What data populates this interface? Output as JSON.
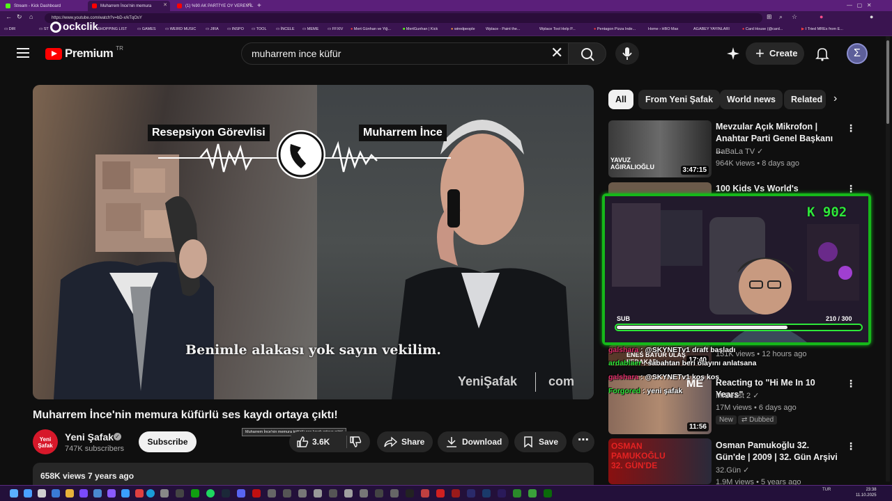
{
  "browser": {
    "tabs": [
      {
        "label": "Stream - Kick Dashboard",
        "color": "#53fc18"
      },
      {
        "label": "Muharrem İnce'nin memura",
        "color": "#ff0000"
      },
      {
        "label": "(1) %90 AK PARTİ'YE OY VEREN İL",
        "color": "#ff0000"
      }
    ],
    "new_tab": "+",
    "url": "https://www.youtube.com/watch?v=bD-x/kTqOsY",
    "bookmarks": [
      "DIR",
      "ST",
      "SHOPPING LIST",
      "GAMES",
      "WEIRD MUSIC",
      "JIRA",
      "INSPO",
      "TOOL",
      "İNCELE",
      "MEME",
      "FFXIV",
      "Mert Günhan ve Yiğ...",
      "MertGunhan | Kick",
      "wiredpeople",
      "Wplace - Paint the...",
      "Wplace Tool Help P...",
      "Pentagon Pizza Inde...",
      "Home › HBO Max",
      "AGABEY YAYINLARI",
      "Card House (@card...",
      "I Tried MREs from E..."
    ],
    "watermark": "ockclik"
  },
  "masthead": {
    "logo_text": "Premium",
    "country": "TR",
    "search_value": "muharrem ince küfür",
    "create_label": "Create",
    "avatar_glyph": "Σ"
  },
  "video": {
    "label_left": "Resepsiyon Görevlisi",
    "label_right": "Muharrem İnce",
    "subtitle": "Benimle alakası yok sayın vekilim.",
    "watermark_left": "YeniŞafak",
    "watermark_right": "com"
  },
  "meta": {
    "title": "Muharrem İnce'nin memura küfürlü ses kaydı ortaya çıktı!",
    "tooltip": "Muharrem İnce'nin memura küfürlü ses kaydı ortaya çıktı!",
    "channel_avatar": "Yeni Şafak",
    "channel": "Yeni Şafak",
    "subscribers": "747K subscribers",
    "subscribe": "Subscribe",
    "likes": "3.6K",
    "share": "Share",
    "download": "Download",
    "save": "Save",
    "views_line": "658K views  7 years ago"
  },
  "chips": [
    "All",
    "From Yeni Şafak",
    "World news",
    "Related"
  ],
  "sidebar": [
    {
      "title": "Mevzular Açık Mikrofon | Anahtar Parti Genel Başkanı ...",
      "channel": "BaBaLa TV",
      "meta": "964K views • 8 days ago",
      "duration": "3:47:15",
      "thumb_text": "YAVUZ AĞIRALIOĞLU"
    },
    {
      "title": "100 Kids Vs World's Strongest",
      "channel": "",
      "meta": "",
      "duration": "",
      "thumb_text": ""
    },
    {
      "title": "",
      "channel": "",
      "meta": "131K views • 12 hours ago",
      "duration": "17:40",
      "thumb_text": "ENES BATUR ULAŞ FEDAKAR"
    },
    {
      "title": "Reacting to \"Hi Me In 10 Years\"",
      "channel": "MrBeast 2",
      "meta": "17M views • 6 days ago",
      "duration": "11:56",
      "badges": [
        "New",
        "Dubbed"
      ],
      "thumb_text": "ME"
    },
    {
      "title": "Osman Pamukoğlu 32. Gün'de | 2009 | 32. Gün Arşivi",
      "channel": "32.Gün",
      "meta": "1.9M views • 5 years ago",
      "duration": "",
      "thumb_text": "OSMAN PAMUKOĞLU 32. GÜN'DE"
    }
  ],
  "stream_overlay": {
    "code": "K 902",
    "sub_label": "SUB",
    "sub_count": "210  /  300",
    "sub_progress": 0.7
  },
  "chat": [
    {
      "user": "galshara",
      "text": ": @SKYNETv1 draft başladı"
    },
    {
      "user": "ardablaer",
      "text": ": sabahtan beri olayını anlatsana"
    },
    {
      "user": "galshara",
      "text": ": @SKYNETv1 koş koş"
    },
    {
      "user": "Forgored",
      "text": ": yeni şafak"
    }
  ],
  "taskbar": {
    "tray": "TUR",
    "time": "23:38",
    "date": "11.10.2025"
  },
  "colors": {
    "brand_red": "#ff0000",
    "overlay_green": "#2ee83a",
    "chat_pink": "#e1306c",
    "bg": "#0f0f0f",
    "chrome": "#5b1f7a"
  }
}
